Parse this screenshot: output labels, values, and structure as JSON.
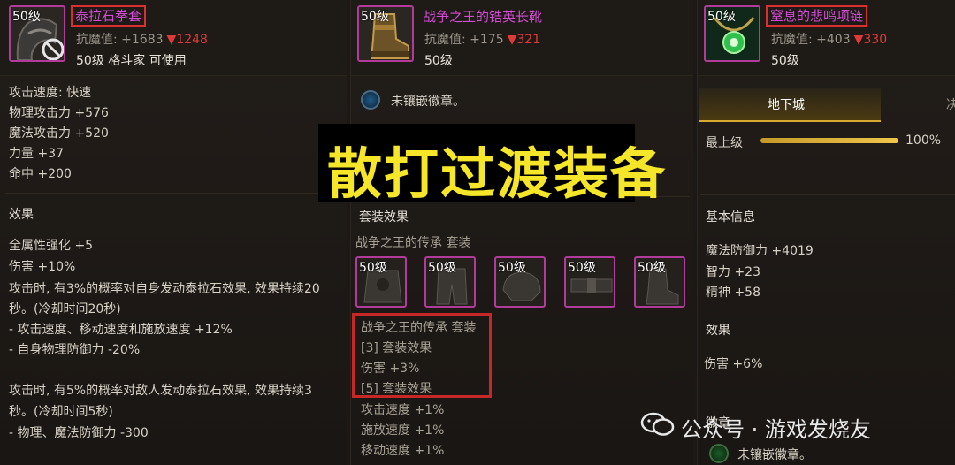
{
  "overlay_title": "散打过渡装备",
  "watermark": "公众号 · 游戏发烧友",
  "colors": {
    "rarity_border": "#b23a9b",
    "name": "#d54bd6",
    "down": "#e0393a",
    "highlight_frame": "#c62828",
    "overlay_text": "#f5e62a",
    "gold": "#d8a931"
  },
  "item1": {
    "level_tag": "50级",
    "name": "泰拉石拳套",
    "resist_label": "抗魔值: +1683",
    "resist_diff": "▼1248",
    "sub": "50级 格斗家 可使用",
    "icon": "gauntlet-icon",
    "stats": [
      "攻击速度: 快速",
      "物理攻击力 +576",
      "魔法攻击力 +520",
      "力量 +37",
      "命中 +200"
    ],
    "effect_title": "效果",
    "effects": [
      "全属性强化 +5",
      "伤害 +10%",
      "攻击时, 有3%的概率对自身发动泰拉石效果, 效果持续20",
      "秒。(冷却时间20秒)",
      " - 攻击速度、移动速度和施放速度 +12%",
      " - 自身物理防御力 -20%",
      "",
      "攻击时, 有5%的概率对敌人发动泰拉石效果, 效果持续3",
      "秒。(冷却时间5秒)",
      " - 物理、魔法防御力 -300"
    ]
  },
  "item2": {
    "level_tag": "50级",
    "name": "战争之王的锆英长靴",
    "resist_label": "抗魔值: +175",
    "resist_diff": "▼321",
    "sub": "50级",
    "icon": "boots-icon",
    "emblem": "未镶嵌徽章。",
    "set_title": "套装效果",
    "set_name": "战争之王的传承  套装",
    "set_items": [
      {
        "level": "50级",
        "icon": "chest-armor-icon"
      },
      {
        "level": "50级",
        "icon": "pants-armor-icon"
      },
      {
        "level": "50级",
        "icon": "shoulder-armor-icon"
      },
      {
        "level": "50级",
        "icon": "belt-armor-icon"
      },
      {
        "level": "50级",
        "icon": "boots-armor-icon"
      }
    ],
    "set_lines": [
      "战争之王的传承  套装",
      "[3] 套装效果",
      "伤害 +3%",
      "[5] 套装效果",
      "攻击速度 +1%",
      "施放速度 +1%",
      "移动速度 +1%"
    ]
  },
  "item3": {
    "level_tag": "50级",
    "name": "窒息的悲鸣项链",
    "resist_label": "抗魔值: +403",
    "resist_diff": "▼330",
    "sub": "50级",
    "icon": "necklace-icon",
    "tab_active": "地下城",
    "tab_next": "决",
    "upgrade_label": "最上级",
    "upgrade_percent": "100%",
    "upgrade_fraction": 1.0,
    "basic_title": "基本信息",
    "basic_lines": [
      "魔法防御力 +4019",
      "智力 +23",
      "精神 +58"
    ],
    "effect_title": "效果",
    "effects": [
      "伤害 +6%"
    ],
    "emblem_title": "徽章",
    "emblem": "未镶嵌徽章。"
  }
}
